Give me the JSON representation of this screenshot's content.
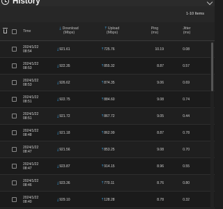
{
  "header": {
    "title": "History"
  },
  "toolbar": {
    "items_label": "1-10 Items"
  },
  "table": {
    "headers": {
      "time": "Time",
      "download": "Download",
      "download_unit": "(Mbps)",
      "upload": "Upload",
      "upload_unit": "(Mbps)",
      "ping": "Ping",
      "ping_unit": "(ms)",
      "jitter": "Jitter",
      "jitter_unit": "(ms)"
    },
    "rows": [
      {
        "date": "2024/1/22",
        "time": "08:54",
        "download": "921.61",
        "upload": "725.76",
        "ping": "10.19",
        "jitter": "0.08"
      },
      {
        "date": "2024/1/22",
        "time": "08:53",
        "download": "922.35",
        "upload": "855.32",
        "ping": "8.87",
        "jitter": "0.57"
      },
      {
        "date": "2024/1/22",
        "time": "08:53",
        "download": "926.62",
        "upload": "874.35",
        "ping": "9.06",
        "jitter": "0.69"
      },
      {
        "date": "2024/1/22",
        "time": "08:51",
        "download": "922.75",
        "upload": "884.60",
        "ping": "9.08",
        "jitter": "0.74"
      },
      {
        "date": "2024/1/22",
        "time": "08:51",
        "download": "921.72",
        "upload": "867.72",
        "ping": "9.05",
        "jitter": "0.44"
      },
      {
        "date": "2024/1/22",
        "time": "08:48",
        "download": "921.18",
        "upload": "862.99",
        "ping": "8.87",
        "jitter": "0.78"
      },
      {
        "date": "2024/1/22",
        "time": "08:47",
        "download": "921.56",
        "upload": "853.25",
        "ping": "9.08",
        "jitter": "0.70"
      },
      {
        "date": "2024/1/22",
        "time": "08:47",
        "download": "923.87",
        "upload": "914.15",
        "ping": "8.96",
        "jitter": "0.55"
      },
      {
        "date": "2024/1/22",
        "time": "08:46",
        "download": "923.36",
        "upload": "770.11",
        "ping": "8.76",
        "jitter": "0.80"
      },
      {
        "date": "2024/1/22",
        "time": "08:40",
        "download": "929.10",
        "upload": "128.28",
        "ping": "8.78",
        "jitter": "0.32"
      }
    ]
  },
  "icons": {
    "history": "clock-history-icon",
    "collapse": "chevron-down-icon",
    "delete": "trash-icon",
    "download": "download-arrow-icon",
    "upload": "upload-arrow-icon"
  },
  "colors": {
    "accent": "#3aa3e3",
    "background": "#1d1d1d",
    "header": "#2b2b2b"
  }
}
